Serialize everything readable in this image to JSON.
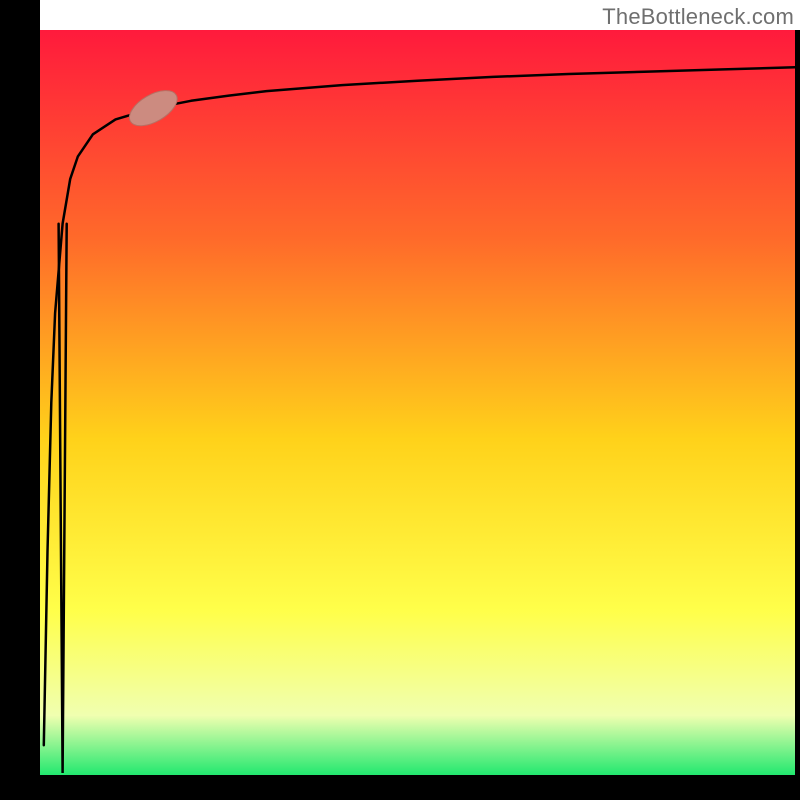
{
  "attribution": "TheBottleneck.com",
  "colors": {
    "text": "#6f6f6f",
    "axis": "#000000",
    "curve": "#000000",
    "marker_fill": "#cc8b80",
    "gradient_top": "#ff1a3c",
    "gradient_mid_upper": "#ff6a2a",
    "gradient_mid": "#ffd21a",
    "gradient_mid_lower": "#ffff4a",
    "gradient_lower": "#f0ffb0",
    "gradient_bottom": "#22e86f"
  },
  "chart_data": {
    "type": "line",
    "title": "",
    "xlabel": "",
    "ylabel": "",
    "xlim": [
      0,
      100
    ],
    "ylim": [
      0,
      100
    ],
    "grid": false,
    "legend": false,
    "x": [
      0.5,
      1,
      1.5,
      2,
      3,
      4,
      5,
      7,
      10,
      15,
      20,
      25,
      30,
      40,
      50,
      60,
      70,
      80,
      90,
      100
    ],
    "values": [
      4,
      30,
      50,
      62,
      74,
      80,
      83,
      86,
      88,
      89.5,
      90.5,
      91.2,
      91.8,
      92.6,
      93.2,
      93.7,
      94.1,
      94.4,
      94.7,
      95
    ],
    "marker": {
      "x": 15,
      "y": 89.5,
      "width_x": 7,
      "width_y": 2,
      "angle_deg": 30
    },
    "notch": {
      "x": 3,
      "depth": 100
    }
  }
}
